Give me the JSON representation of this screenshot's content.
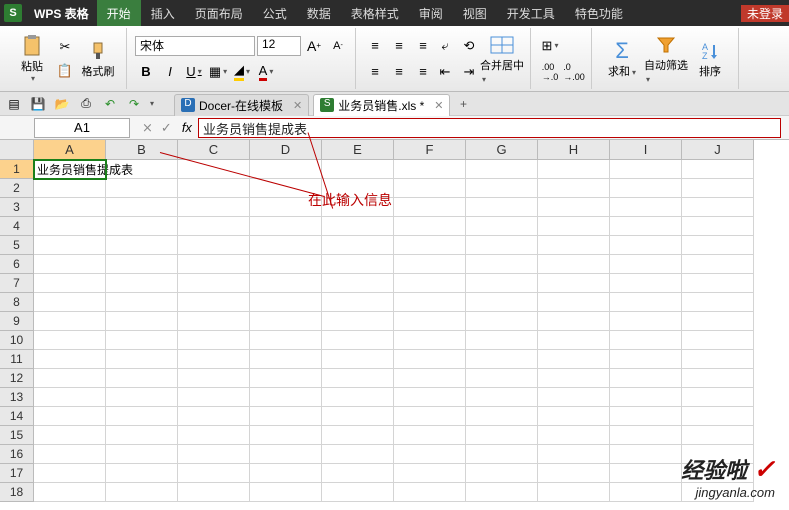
{
  "app": {
    "logo": "S",
    "name": "WPS 表格"
  },
  "menu": [
    "开始",
    "插入",
    "页面布局",
    "公式",
    "数据",
    "表格样式",
    "审阅",
    "视图",
    "开发工具",
    "特色功能"
  ],
  "menu_active": 0,
  "login_badge": "未登录",
  "ribbon": {
    "paste": "粘贴",
    "format_painter": "格式刷",
    "font_name": "宋体",
    "font_size": "12",
    "merge_center": "合并居中",
    "sum": "求和",
    "filter": "自动筛选",
    "sort": "排序"
  },
  "qat": {
    "save_title": "保存",
    "open_title": "打开",
    "print_title": "打印",
    "undo_title": "撤销",
    "redo_title": "重做"
  },
  "doc_tabs": [
    {
      "icon": "D",
      "label": "Docer-在线模板",
      "active": false
    },
    {
      "icon": "S",
      "label": "业务员销售.xls *",
      "active": true
    }
  ],
  "formula": {
    "name_box": "A1",
    "fx": "fx",
    "value": "业务员销售提成表"
  },
  "columns": [
    "A",
    "B",
    "C",
    "D",
    "E",
    "F",
    "G",
    "H",
    "I",
    "J"
  ],
  "rows": [
    "1",
    "2",
    "3",
    "4",
    "5",
    "6",
    "7",
    "8",
    "9",
    "10",
    "11",
    "12",
    "13",
    "14",
    "15",
    "16",
    "17",
    "18"
  ],
  "cells": {
    "A1": "业务员销售提成表"
  },
  "annotation": "在此输入信息",
  "watermark": {
    "line1": "经验啦",
    "check": "✓",
    "line2": "jingyanla.com"
  }
}
